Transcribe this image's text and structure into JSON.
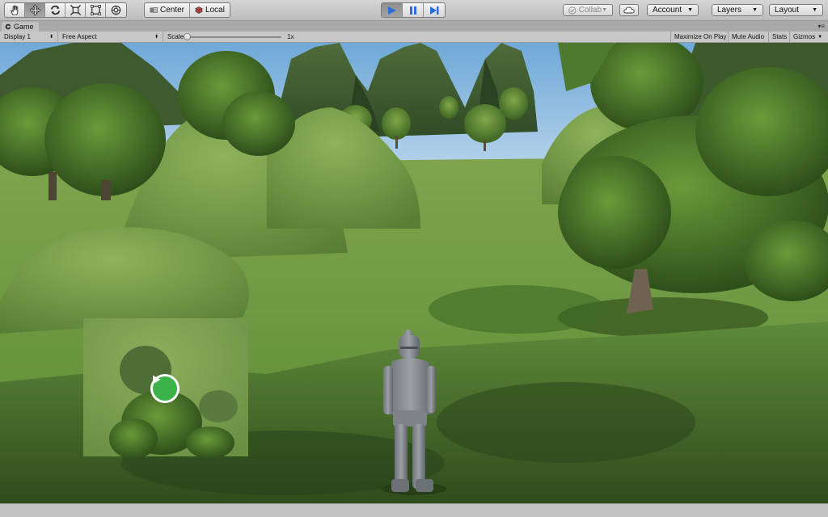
{
  "toolbar": {
    "transform_tools": [
      {
        "icon": "hand-icon"
      },
      {
        "icon": "move-icon"
      },
      {
        "icon": "rotate-icon"
      },
      {
        "icon": "scale-icon"
      },
      {
        "icon": "rect-icon"
      },
      {
        "icon": "transform-icon"
      }
    ],
    "pivot_label": "Center",
    "space_label": "Local",
    "playback": [
      {
        "icon": "play-icon",
        "active": true
      },
      {
        "icon": "pause-icon",
        "active": false
      },
      {
        "icon": "step-icon",
        "active": false
      }
    ],
    "collab_label": "Collab",
    "account_label": "Account",
    "layers_label": "Layers",
    "layout_label": "Layout",
    "accent_color": "#2a6fd6"
  },
  "game_tab": {
    "title": "Game"
  },
  "game_bar": {
    "display": "Display 1",
    "aspect": "Free Aspect",
    "scale_label": "Scale",
    "scale_value": "1x",
    "scale_fraction": 0.0,
    "maximize_on_play": "Maximize On Play",
    "mute_audio": "Mute Audio",
    "stats": "Stats",
    "gizmos": "Gizmos"
  },
  "scene": {
    "minimap_icon": "play-circle-icon",
    "minimap_icon_color": "#3cb24a"
  }
}
